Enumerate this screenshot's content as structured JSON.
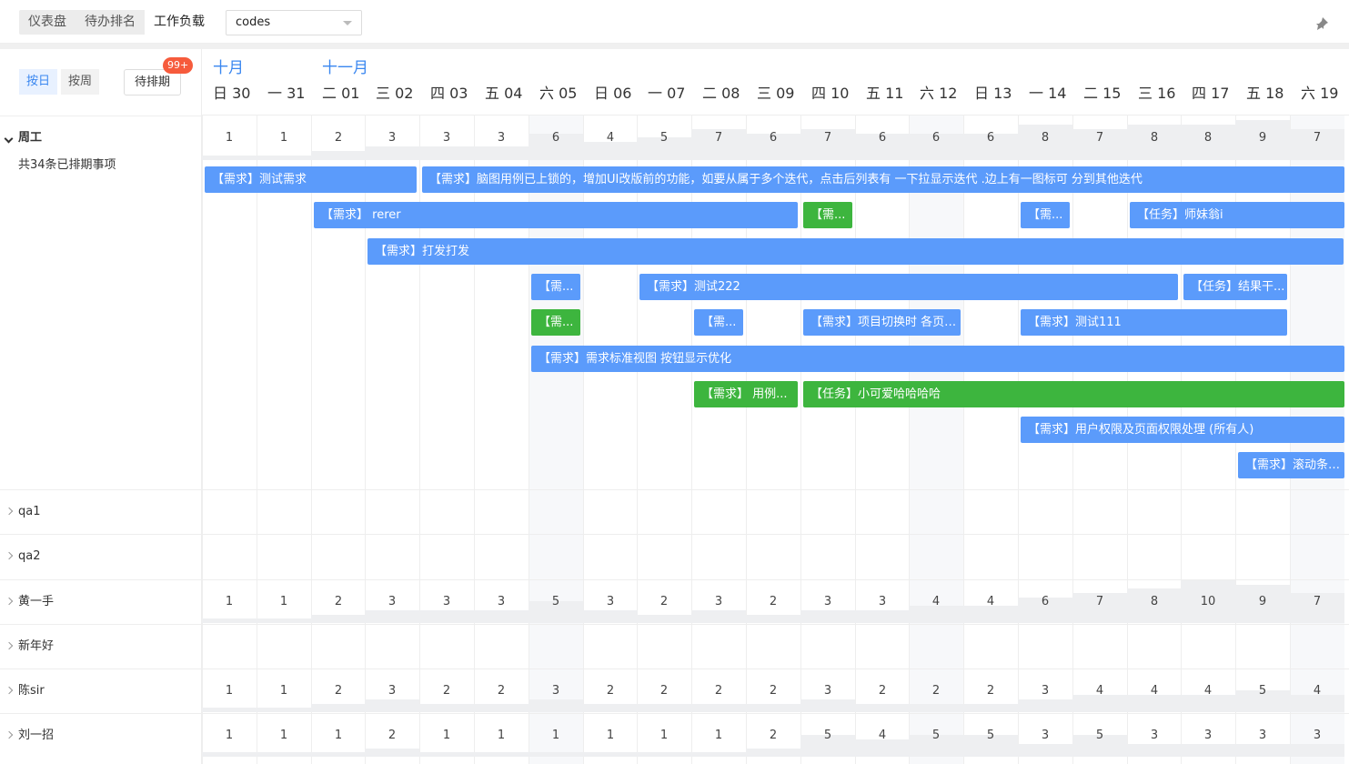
{
  "top_tabs": [
    "仪表盘",
    "待办排名",
    "工作负载"
  ],
  "project_select": "codes",
  "view": {
    "by_day": "按日",
    "by_week": "按周",
    "pending": "待排期",
    "pending_badge": "99+"
  },
  "months": [
    {
      "label": "十月",
      "col": 0
    },
    {
      "label": "十一月",
      "col": 2
    }
  ],
  "days": [
    "日 30",
    "一 31",
    "二 01",
    "三 02",
    "四 03",
    "五 04",
    "六 05",
    "日 06",
    "一 07",
    "二 08",
    "三 09",
    "四 10",
    "五 11",
    "六 12",
    "日 13",
    "一 14",
    "二 15",
    "三 16",
    "四 17",
    "五 18",
    "六 19"
  ],
  "weekend_cols": [
    6,
    13,
    20
  ],
  "group": {
    "name": "周工",
    "summary": "共34条已排期事项",
    "counts": [
      1,
      1,
      2,
      3,
      3,
      3,
      6,
      4,
      5,
      7,
      6,
      7,
      6,
      6,
      6,
      8,
      7,
      8,
      8,
      9,
      7
    ]
  },
  "bars": [
    {
      "row": 0,
      "start": 0,
      "end": 3.95,
      "label": "【需求】测试需求",
      "color": "blue"
    },
    {
      "row": 0,
      "start": 4,
      "end": 21,
      "label": "【需求】脑图用例已上锁的，增加UI改版前的功能，如要从属于多个迭代，点击后列表有 一下拉显示迭代 .边上有一图标可 分到其他迭代",
      "color": "blue"
    },
    {
      "row": 1,
      "start": 2,
      "end": 10.95,
      "label": "【需求】 rerer",
      "color": "blue"
    },
    {
      "row": 1,
      "start": 11,
      "end": 11.95,
      "label": "【需...",
      "color": "green"
    },
    {
      "row": 1,
      "start": 15,
      "end": 15.95,
      "label": "【需...",
      "color": "blue"
    },
    {
      "row": 1,
      "start": 17,
      "end": 21,
      "label": "【任务】师妹翁i",
      "color": "blue"
    },
    {
      "row": 2,
      "start": 3,
      "end": 21,
      "label": "【需求】打发打发",
      "color": "blue"
    },
    {
      "row": 3,
      "start": 6,
      "end": 6.95,
      "label": "【需...",
      "color": "blue"
    },
    {
      "row": 3,
      "start": 8,
      "end": 17.95,
      "label": "【需求】测试222",
      "color": "blue"
    },
    {
      "row": 3,
      "start": 18,
      "end": 19.95,
      "label": "【任务】结果干...",
      "color": "blue"
    },
    {
      "row": 4,
      "start": 6,
      "end": 6.95,
      "label": "【需...",
      "color": "green"
    },
    {
      "row": 4,
      "start": 9,
      "end": 9.95,
      "label": "【需...",
      "color": "blue"
    },
    {
      "row": 4,
      "start": 11,
      "end": 13.95,
      "label": "【需求】项目切换时 各页刷新 (所有...",
      "color": "blue"
    },
    {
      "row": 4,
      "start": 15,
      "end": 19.95,
      "label": "【需求】测试111",
      "color": "blue"
    },
    {
      "row": 5,
      "start": 6,
      "end": 21,
      "label": "【需求】需求标准视图 按钮显示优化",
      "color": "blue"
    },
    {
      "row": 6,
      "start": 9,
      "end": 10.95,
      "label": "【需求】 用例...",
      "color": "green"
    },
    {
      "row": 6,
      "start": 11,
      "end": 21,
      "label": "【任务】小可爱哈哈哈哈",
      "color": "green"
    },
    {
      "row": 7,
      "start": 15,
      "end": 21,
      "label": "【需求】用户权限及页面权限处理 (所有人)",
      "color": "blue"
    },
    {
      "row": 8,
      "start": 19,
      "end": 21,
      "label": "【需求】滚动条做成",
      "color": "blue"
    }
  ],
  "members": [
    {
      "name": "qa1",
      "counts": []
    },
    {
      "name": "qa2",
      "counts": []
    },
    {
      "name": "黄一手",
      "counts": [
        1,
        1,
        2,
        3,
        3,
        3,
        5,
        3,
        2,
        3,
        2,
        3,
        3,
        4,
        4,
        6,
        7,
        8,
        10,
        9,
        7
      ],
      "highlight_col": 18
    },
    {
      "name": "新年好",
      "counts": []
    },
    {
      "name": "陈sir",
      "counts": [
        1,
        1,
        2,
        3,
        2,
        2,
        3,
        2,
        2,
        2,
        2,
        3,
        2,
        2,
        2,
        3,
        4,
        4,
        4,
        5,
        4
      ]
    },
    {
      "name": "刘一招",
      "counts": [
        1,
        1,
        1,
        2,
        1,
        1,
        1,
        1,
        1,
        1,
        2,
        5,
        4,
        5,
        5,
        3,
        5,
        3,
        3,
        3,
        3
      ]
    }
  ],
  "colors": {
    "accent": "#3a87f0",
    "blue_bar": "#5b9bfb",
    "green_bar": "#3db53e",
    "badge": "#f65b3c",
    "overload": "#fde8e8"
  }
}
